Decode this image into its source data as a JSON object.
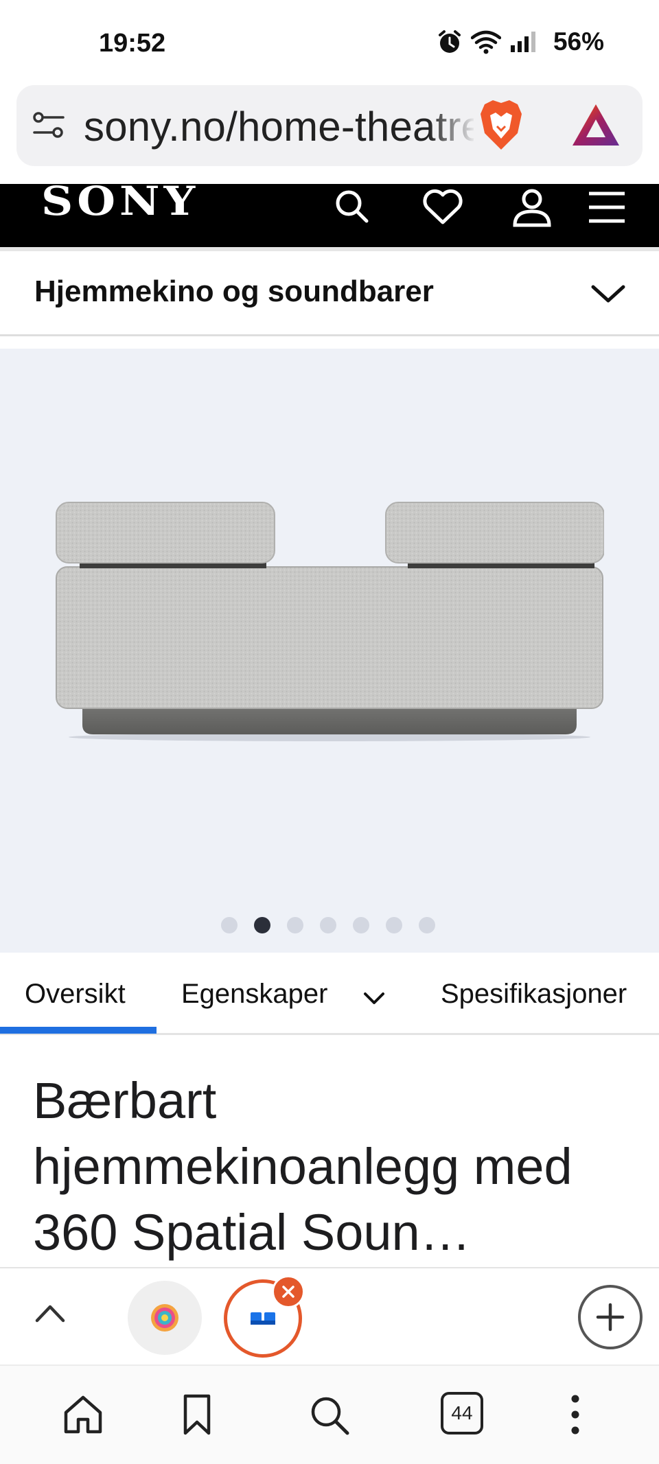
{
  "status_bar": {
    "time": "19:52",
    "battery": "56%",
    "icons": [
      "alarm-icon",
      "wifi-icon",
      "signal-icon"
    ]
  },
  "browser": {
    "url": "sony.no/home-theatre",
    "url_visible": "sony.no/home-the",
    "icons": [
      "tune-icon",
      "brave-shield-icon",
      "bat-rewards-icon"
    ]
  },
  "sony_header": {
    "logo": "SONY",
    "icons": [
      "search-icon",
      "heart-icon",
      "account-icon",
      "menu-icon"
    ]
  },
  "category": {
    "label": "Hjemmekino og soundbarer"
  },
  "gallery": {
    "slide_count": 7,
    "active_slide": 2
  },
  "tabs": [
    {
      "label": "Oversikt",
      "active": true
    },
    {
      "label": "Egenskaper",
      "has_dropdown": true
    },
    {
      "label": "Spesifikasjoner"
    }
  ],
  "product": {
    "title": "Bærbart hjemmekinoanlegg med 360 Spatial Soun…"
  },
  "tab_strip": {
    "open_tabs": 44
  },
  "colors": {
    "accent_blue": "#1f6fe0",
    "brave_orange": "#e4582b",
    "header_black": "#000000",
    "gallery_bg": "#eef1f7"
  }
}
